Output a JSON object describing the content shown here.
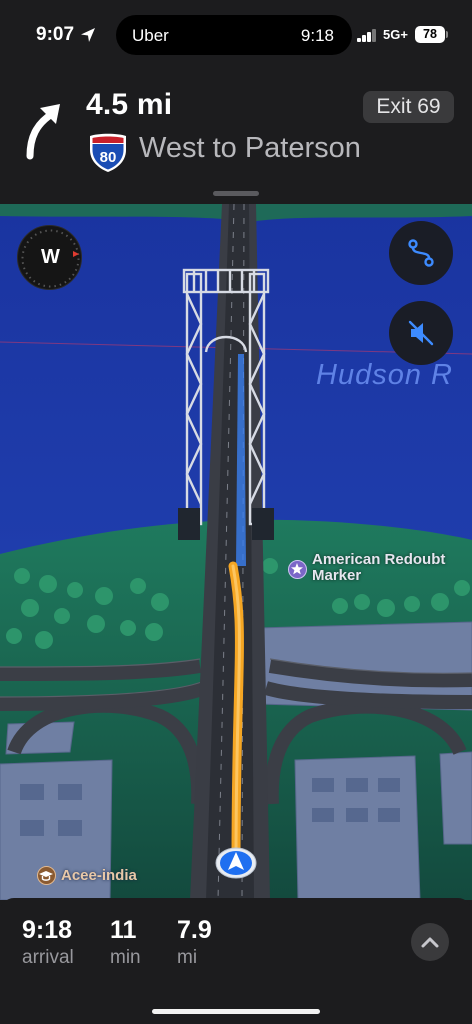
{
  "status_bar": {
    "time": "9:07",
    "location_icon": "location-arrow-icon",
    "island_app": "Uber",
    "island_time": "9:18",
    "network": "5G+",
    "battery": "78"
  },
  "maneuver": {
    "icon": "turn-right-arrow-icon",
    "distance": "4.5 mi",
    "shield_number": "80",
    "road": "West to Paterson",
    "exit": "Exit 69"
  },
  "map": {
    "compass_heading": "W",
    "water_label": "Hudson R",
    "poi_1": {
      "icon": "star-icon",
      "label": "American Redoubt Marker"
    },
    "poi_2": {
      "icon": "graduation-cap-icon",
      "label": "Acee-india"
    },
    "buttons": [
      "route-overview-icon",
      "speaker-muted-icon"
    ],
    "colors": {
      "water": "#1e3aa4",
      "route": "#f5a623",
      "land": "#1f6e58"
    }
  },
  "trip": {
    "arrival": {
      "value": "9:18",
      "unit": "arrival"
    },
    "duration": {
      "value": "11",
      "unit": "min"
    },
    "distance": {
      "value": "7.9",
      "unit": "mi"
    },
    "expand_icon": "chevron-up-icon"
  }
}
